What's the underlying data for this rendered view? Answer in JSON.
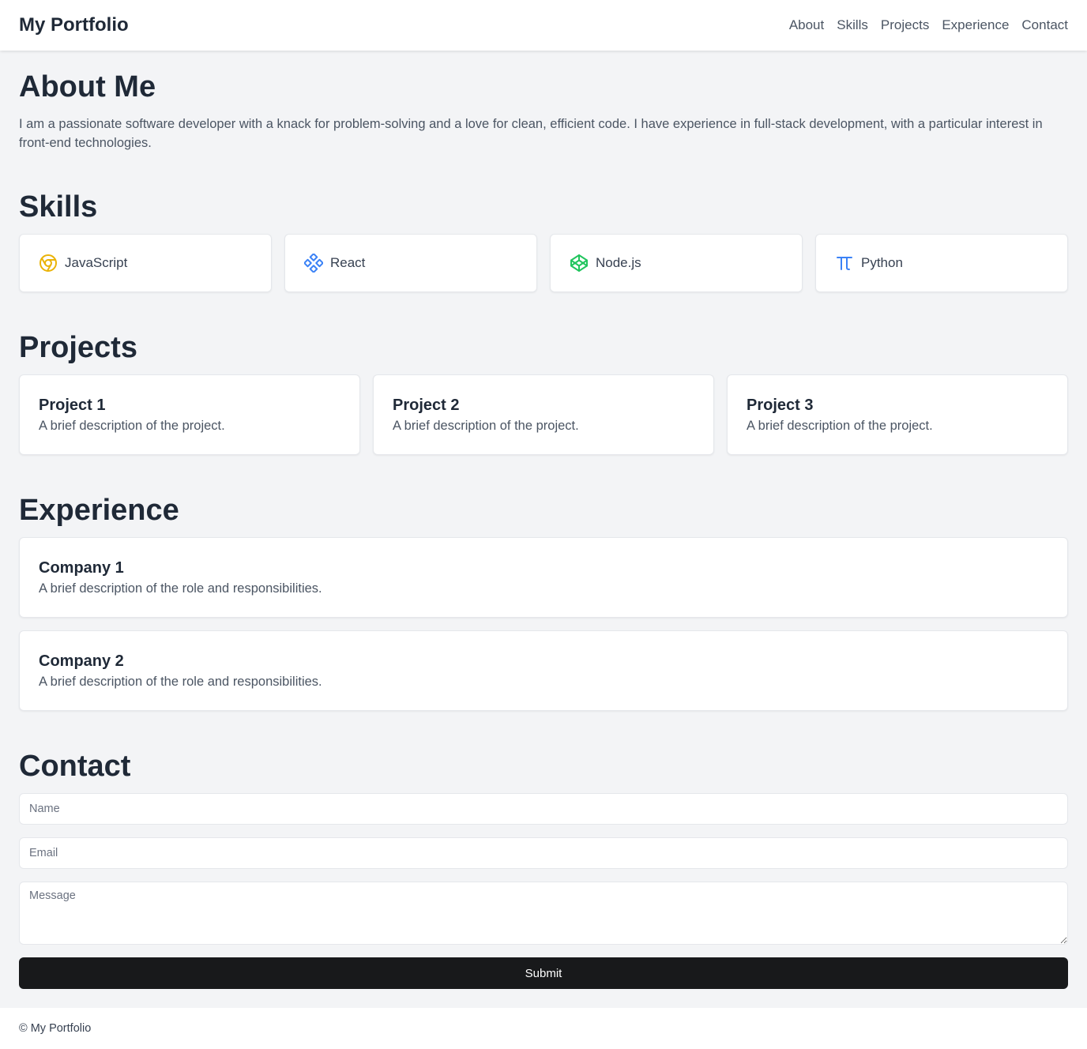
{
  "header": {
    "brand": "My Portfolio",
    "nav": [
      {
        "label": "About",
        "name": "nav-about"
      },
      {
        "label": "Skills",
        "name": "nav-skills"
      },
      {
        "label": "Projects",
        "name": "nav-projects"
      },
      {
        "label": "Experience",
        "name": "nav-experience"
      },
      {
        "label": "Contact",
        "name": "nav-contact"
      }
    ]
  },
  "about": {
    "title": "About Me",
    "text": "I am a passionate software developer with a knack for problem-solving and a love for clean, efficient code. I have experience in full-stack development, with a particular interest in front-end technologies."
  },
  "skills": {
    "title": "Skills",
    "items": [
      {
        "label": "JavaScript",
        "icon": "chrome-icon",
        "color": "#eab308"
      },
      {
        "label": "React",
        "icon": "codesandbox-icon",
        "color": "#3b82f6"
      },
      {
        "label": "Node.js",
        "icon": "codepen-icon",
        "color": "#22c55e"
      },
      {
        "label": "Python",
        "icon": "pi-icon",
        "color": "#3b82f6"
      }
    ]
  },
  "projects": {
    "title": "Projects",
    "items": [
      {
        "title": "Project 1",
        "desc": "A brief description of the project."
      },
      {
        "title": "Project 2",
        "desc": "A brief description of the project."
      },
      {
        "title": "Project 3",
        "desc": "A brief description of the project."
      }
    ]
  },
  "experience": {
    "title": "Experience",
    "items": [
      {
        "title": "Company 1",
        "desc": "A brief description of the role and responsibilities."
      },
      {
        "title": "Company 2",
        "desc": "A brief description of the role and responsibilities."
      }
    ]
  },
  "contact": {
    "title": "Contact",
    "name_placeholder": "Name",
    "email_placeholder": "Email",
    "message_placeholder": "Message",
    "submit_label": "Submit"
  },
  "footer": {
    "text": "© My Portfolio"
  },
  "colors": {
    "background": "#f3f4f6",
    "button": "#18191b",
    "heading": "#1f2937"
  }
}
